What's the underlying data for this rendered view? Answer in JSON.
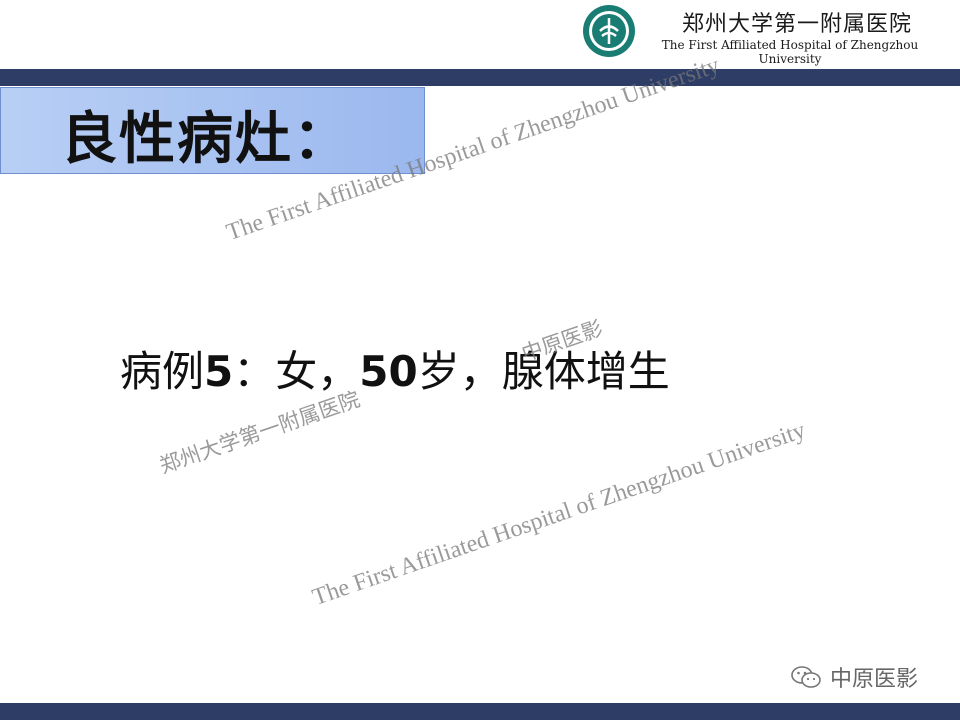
{
  "header": {
    "hospital_name_cn": "郑州大学第一附属医院",
    "hospital_name_en": "The First Affiliated Hospital of Zhengzhou University",
    "logo_icon": "hospital-logo-icon"
  },
  "slide": {
    "title": "良性病灶：",
    "case_prefix": "病例",
    "case_number": "5",
    "case_sep1": "：女，",
    "case_age": "50",
    "case_sep2": "岁，腺体增生"
  },
  "watermarks": {
    "en": "The First Affiliated Hospital of Zhengzhou University",
    "cn_hospital": "郑州大学第一附属医院",
    "cn_brand": "中原医影"
  },
  "footer": {
    "wechat_label": "中原医影",
    "wechat_icon": "wechat-icon"
  },
  "colors": {
    "bar": "#2d3d66",
    "title_box": "#a9c3f2",
    "logo": "#1a7d74"
  }
}
